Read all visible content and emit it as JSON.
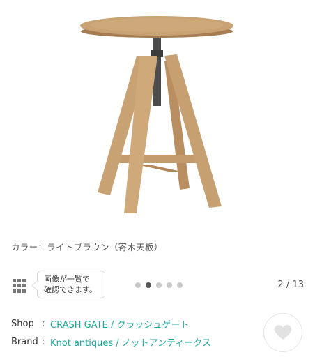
{
  "product": {
    "image_alt": "stool",
    "caption": "カラー：ライトブラウン（寄木天板）"
  },
  "gallery": {
    "tooltip_line1": "画像が一覧で",
    "tooltip_line2": "確認できます。",
    "dot_count": 5,
    "active_dot": 2,
    "counter": "2 / 13"
  },
  "info": {
    "shop_label": "Shop",
    "shop_value": "CRASH GATE / クラッシュゲート",
    "brand_label": "Brand",
    "brand_value": "Knot antiques / ノットアンティークス",
    "colon": ":"
  },
  "icons": {
    "grid": "grid-icon",
    "heart": "heart-icon"
  }
}
